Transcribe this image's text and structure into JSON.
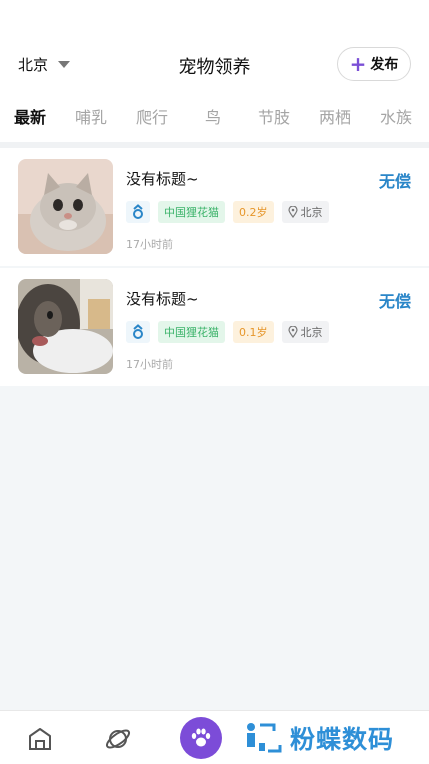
{
  "header": {
    "city": "北京",
    "title": "宠物领养",
    "publish_label": "发布"
  },
  "tabs": [
    {
      "label": "最新",
      "active": true
    },
    {
      "label": "哺乳"
    },
    {
      "label": "爬行"
    },
    {
      "label": "鸟"
    },
    {
      "label": "节肢"
    },
    {
      "label": "两栖"
    },
    {
      "label": "水族"
    }
  ],
  "listings": [
    {
      "title": "没有标题~",
      "price": "无偿",
      "sex_icon": "male-symbol-icon",
      "breed": "中国狸花猫",
      "age": "0.2岁",
      "location": "北京",
      "time": "17小时前"
    },
    {
      "title": "没有标题~",
      "price": "无偿",
      "sex_icon": "male-symbol-icon",
      "breed": "中国狸花猫",
      "age": "0.1岁",
      "location": "北京",
      "time": "17小时前"
    }
  ],
  "bottom_nav": {
    "items": [
      "home-icon",
      "planet-icon",
      "paw-icon"
    ],
    "brand_name": "粉蝶数码"
  },
  "colors": {
    "accent_purple": "#7c4cd8",
    "free_blue": "#2a86c8",
    "breed_green": "#3bb36a",
    "age_orange": "#e6962a"
  }
}
